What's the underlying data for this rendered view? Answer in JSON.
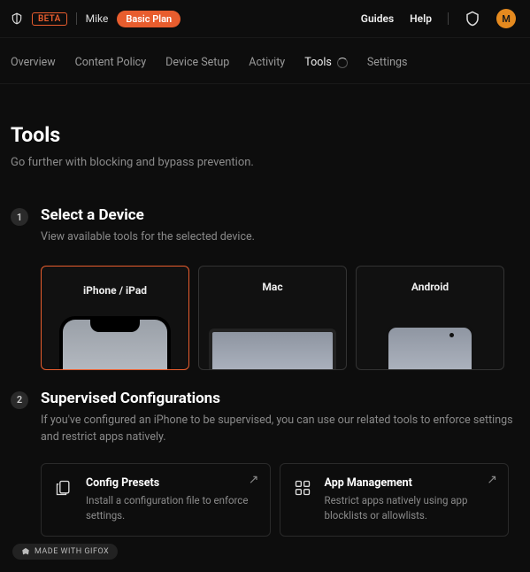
{
  "header": {
    "beta_label": "BETA",
    "username": "Mike",
    "plan": "Basic Plan",
    "links": {
      "guides": "Guides",
      "help": "Help"
    },
    "avatar_initial": "M"
  },
  "nav": {
    "tabs": [
      {
        "label": "Overview"
      },
      {
        "label": "Content Policy"
      },
      {
        "label": "Device Setup"
      },
      {
        "label": "Activity"
      },
      {
        "label": "Tools"
      },
      {
        "label": "Settings"
      }
    ],
    "active_index": 4
  },
  "page": {
    "title": "Tools",
    "subtitle": "Go further with blocking and bypass prevention."
  },
  "step1": {
    "num": "1",
    "title": "Select a Device",
    "desc": "View available tools for the selected device.",
    "devices": [
      {
        "label": "iPhone / iPad"
      },
      {
        "label": "Mac"
      },
      {
        "label": "Android"
      }
    ],
    "selected_index": 0
  },
  "step2": {
    "num": "2",
    "title": "Supervised Configurations",
    "desc": "If you've configured an iPhone to be supervised, you can use our related tools to enforce settings and restrict apps natively.",
    "cards": [
      {
        "title": "Config Presets",
        "desc": "Install a configuration file to enforce settings."
      },
      {
        "title": "App Management",
        "desc": "Restrict apps natively using app blocklists or allowlists."
      }
    ]
  },
  "footer_badge": "MADE WITH GIFOX"
}
